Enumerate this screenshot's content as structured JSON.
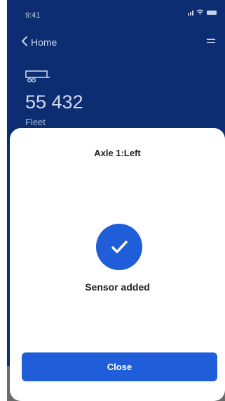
{
  "status_bar": {
    "time": "9:41"
  },
  "nav": {
    "back_label": "Home"
  },
  "vehicle": {
    "number": "55 432",
    "type": "Fleet"
  },
  "sheet": {
    "title": "Axle 1:Left",
    "message": "Sensor added",
    "close_label": "Close"
  },
  "icons": {
    "back": "chevron-left-icon",
    "menu": "hamburger-menu-icon",
    "trailer": "trailer-icon",
    "success": "checkmark-icon",
    "signal": "cellular-signal-icon",
    "wifi": "wifi-icon",
    "battery": "battery-icon"
  },
  "colors": {
    "background": "#0d2d73",
    "accent": "#1f5ed8",
    "sheet": "#ffffff"
  }
}
